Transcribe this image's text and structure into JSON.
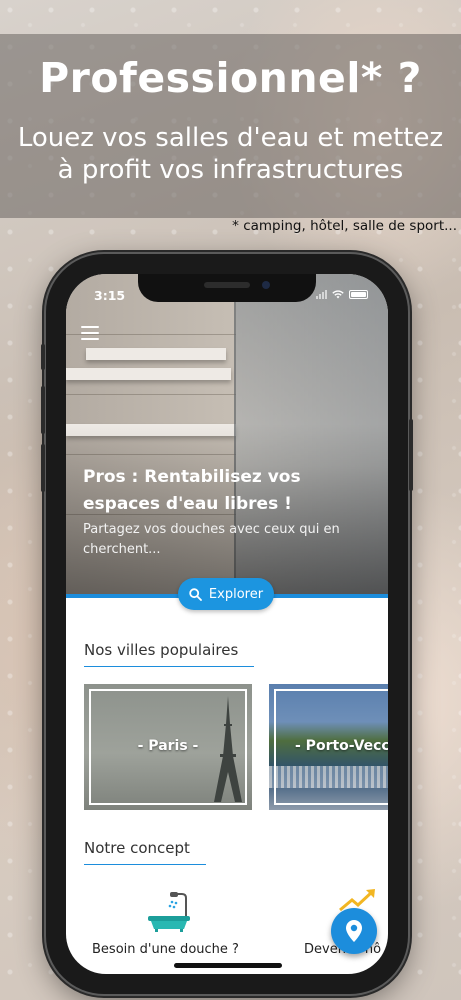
{
  "banner": {
    "title": "Professionnel* ?",
    "subtitle_line1": "Louez vos salles d'eau et mettez",
    "subtitle_line2": "à profit vos infrastructures",
    "note": "* camping, hôtel, salle de sport..."
  },
  "status_bar": {
    "time": "3:15",
    "icons": [
      "signal-icon",
      "wifi-icon",
      "battery-icon"
    ]
  },
  "app": {
    "menu_icon": "hamburger-menu-icon",
    "hero": {
      "title_line1": "Pros : Rentabilisez vos",
      "title_line2": "espaces d'eau libres !",
      "subtitle": "Partagez vos douches avec ceux qui en cherchent..."
    },
    "explore_button": {
      "label": "Explorer",
      "icon": "search-icon"
    },
    "popular_cities": {
      "title": "Nos villes populaires",
      "items": [
        {
          "label": "- Paris -"
        },
        {
          "label": "- Porto-Veccl"
        }
      ]
    },
    "concept": {
      "title": "Notre concept",
      "items": [
        {
          "label": "Besoin d'une douche ?",
          "icon": "bathtub-shower-icon"
        },
        {
          "label": "Devenez hô",
          "icon": "growth-arrow-icon"
        }
      ]
    },
    "fab_icon": "map-pin-icon"
  },
  "colors": {
    "accent": "#1c8ddc",
    "banner_overlay": "#69645f",
    "text_dark": "#333333"
  }
}
